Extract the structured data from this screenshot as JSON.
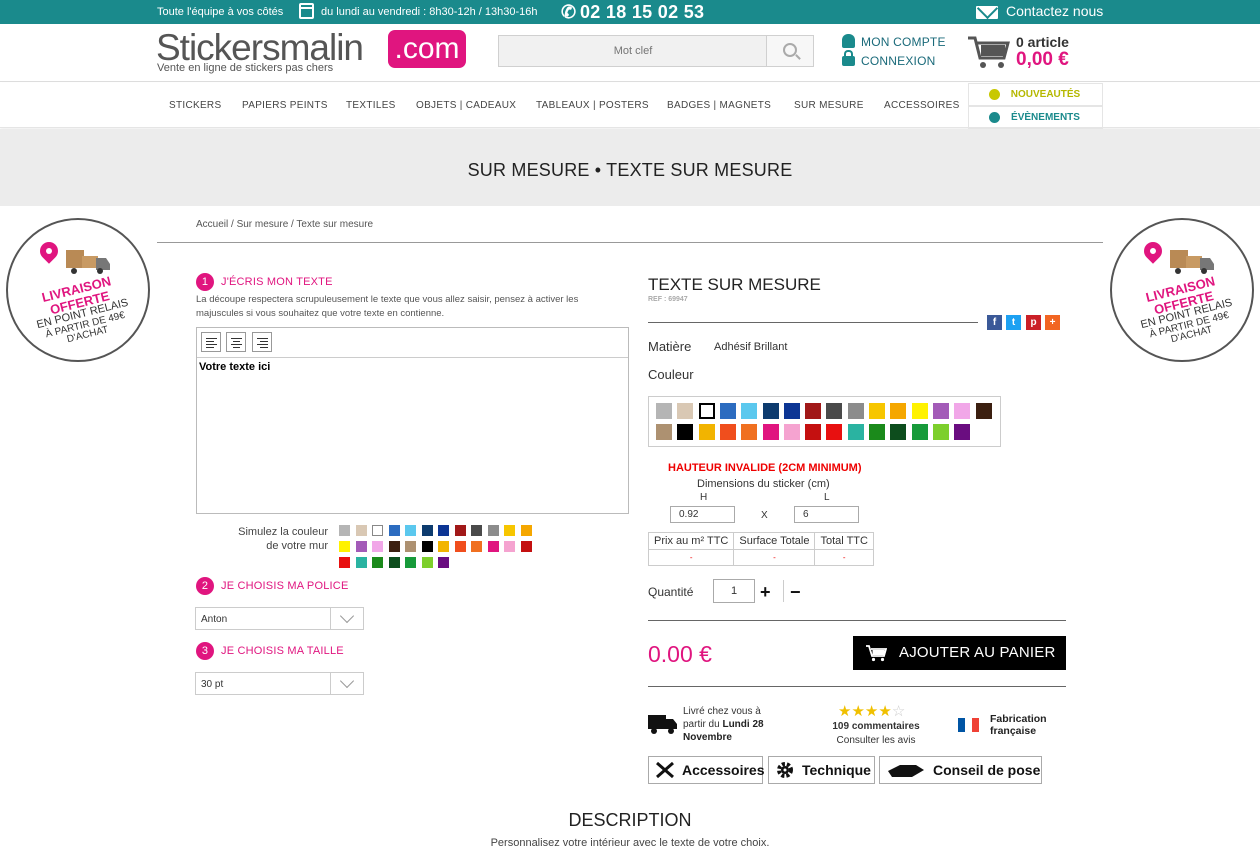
{
  "topbar": {
    "team": "Toute l'équipe à vos côtés",
    "hours": "du lundi au vendredi : 8h30-12h / 13h30-16h",
    "phone": "02 18 15 02 53",
    "contact": "Contactez nous"
  },
  "header": {
    "logo_main": "Stickersmalin",
    "logo_suffix": ".com",
    "tagline": "Vente en ligne de stickers pas chers",
    "search_placeholder": "Mot clef",
    "account": "MON COMPTE",
    "login": "CONNEXION",
    "cart_count": "0 article",
    "cart_total": "0,00 €"
  },
  "nav": {
    "items": [
      "STICKERS",
      "PAPIERS PEINTS",
      "TEXTILES",
      "OBJETS | CADEAUX",
      "TABLEAUX | POSTERS",
      "BADGES | MAGNETS",
      "SUR MESURE",
      "ACCESSOIRES"
    ],
    "news": "NOUVEAUTÉS",
    "events": "ÉVÈNEMENTS"
  },
  "banner": {
    "title": "SUR MESURE • TEXTE SUR MESURE"
  },
  "breadcrumb": "Accueil / Sur mesure / Texte sur mesure",
  "promo": {
    "line1": "LIVRAISON OFFERTE",
    "line2": "EN POINT RELAIS",
    "line3": "À PARTIR DE 49€ D'ACHAT"
  },
  "editor": {
    "step1_num": "1",
    "step1": "J'ÉCRIS MON TEXTE",
    "help": "La découpe respectera scrupuleusement le texte que vous allez saisir, pensez à activer les majuscules si vous souhaitez que votre texte en contienne.",
    "text": "Votre texte ici",
    "wall_label_1": "Simulez la couleur",
    "wall_label_2": "de votre mur",
    "wall_colors": [
      "#b5b5b5",
      "#d9c8b4",
      "#ffffff",
      "#2c6cc0",
      "#5bc8ee",
      "#0d3b6e",
      "#0c3594",
      "#a11818",
      "#4a4a4a",
      "#8c8c8c",
      "#f7c600",
      "#f5a700",
      "#fff200",
      "#a35bb8",
      "#f1a7e8",
      "#3b1f10",
      "#ad9171",
      "#000000",
      "#f2b400",
      "#f04e1d",
      "#f07020",
      "#e0157f",
      "#f5a3d0",
      "#c41010",
      "#e81010",
      "#2ab3a1",
      "#1b8a1b",
      "#0d4d1d",
      "#179a3a",
      "#7dcf2c",
      "#6a0d80"
    ],
    "step2_num": "2",
    "step2": "JE CHOISIS MA POLICE",
    "font": "Anton",
    "step3_num": "3",
    "step3": "JE CHOISIS MA TAILLE",
    "size": "30 pt"
  },
  "product": {
    "title": "TEXTE SUR MESURE",
    "ref": "REF : 69947",
    "material_label": "Matière",
    "material": "Adhésif Brillant",
    "color_label": "Couleur",
    "colors": [
      "#b5b5b5",
      "#d9c8b4",
      "#ffffff",
      "#2c6cc0",
      "#5bc8ee",
      "#0d3b6e",
      "#0c3594",
      "#a11818",
      "#4a4a4a",
      "#8c8c8c",
      "#f7c600",
      "#f5a700",
      "#fff200",
      "#a35bb8",
      "#f1a7e8",
      "#3b1f10",
      "#ad9171",
      "#000000",
      "#f2b400",
      "#f04e1d",
      "#f07020",
      "#e0157f",
      "#f5a3d0",
      "#c41010",
      "#e81010",
      "#2ab3a1",
      "#1b8a1b",
      "#0d4d1d",
      "#179a3a",
      "#7dcf2c",
      "#6a0d80"
    ],
    "error": "HAUTEUR INVALIDE (2CM MINIMUM)",
    "dims_title": "Dimensions du sticker (cm)",
    "h_label": "H",
    "l_label": "L",
    "height": "0.92",
    "x": "X",
    "width": "6",
    "price_headers": [
      "Prix au m² TTC",
      "Surface Totale",
      "Total TTC"
    ],
    "price_values": [
      "-",
      "-",
      "-"
    ],
    "qty_label": "Quantité",
    "qty": "1",
    "plus": "+",
    "minus": "−",
    "price": "0.00 €",
    "add_to_cart": "AJOUTER AU PANIER",
    "delivery_1": "Livré chez vous à",
    "delivery_2": "partir du",
    "delivery_date_1": "Lundi 28",
    "delivery_date_2": "Novembre",
    "rating_stars": 4,
    "reviews": "109 commentaires",
    "reviews_link": "Consulter les avis",
    "made_1": "Fabrication",
    "made_2": "française",
    "btn_accessories": "Accessoires",
    "btn_technique": "Technique",
    "btn_advice": "Conseil de pose"
  },
  "description": {
    "title": "DESCRIPTION",
    "text": "Personnalisez votre intérieur avec le texte de votre choix."
  },
  "colors": {
    "teal": "#1a8a8c",
    "pink": "#e0157f",
    "error": "#e00000"
  }
}
